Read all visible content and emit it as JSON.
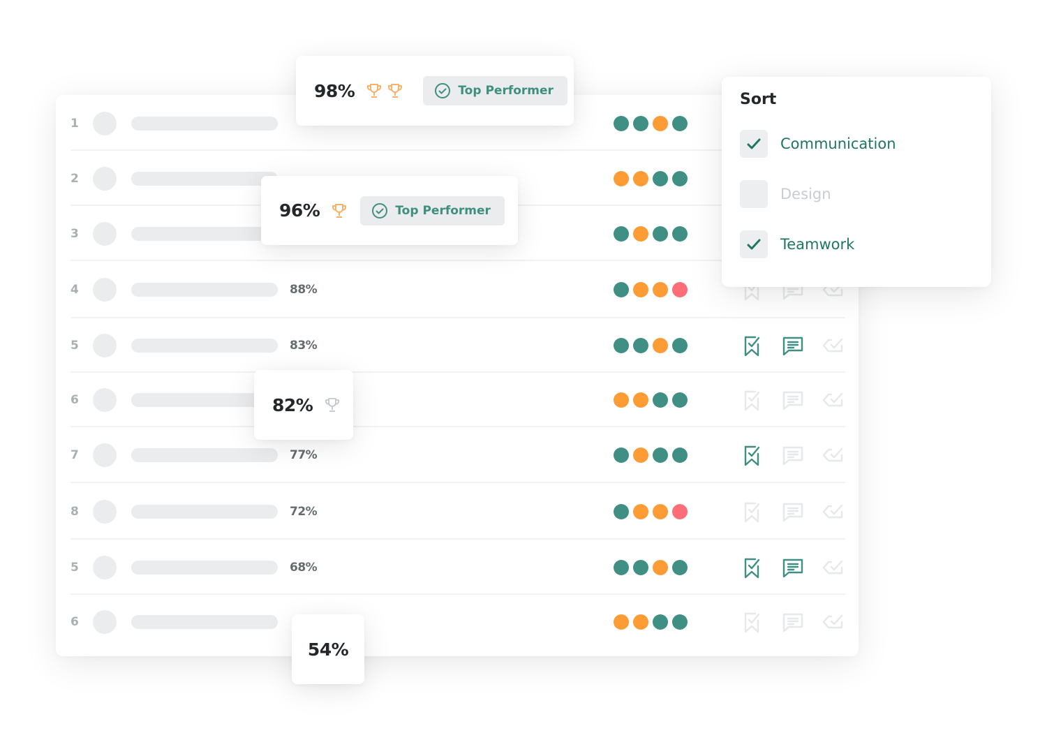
{
  "colors": {
    "teal": "#3f8f84",
    "orange": "#fd9b34",
    "red": "#fd6e78",
    "active_icon": "#3f8f84",
    "inactive_icon": "#e6e8e9",
    "trophy_gold": "#f7b26a",
    "trophy_grey": "#c3c7c9"
  },
  "leaderboard": {
    "rows": [
      {
        "rank": "1",
        "score": "",
        "dots": [
          "teal",
          "teal",
          "orange",
          "teal"
        ],
        "actions": {
          "bookmark": null,
          "comment": null,
          "approve": null
        }
      },
      {
        "rank": "2",
        "score": "",
        "dots": [
          "orange",
          "orange",
          "teal",
          "teal"
        ],
        "actions": {
          "bookmark": null,
          "comment": null,
          "approve": null
        }
      },
      {
        "rank": "3",
        "score": "",
        "dots": [
          "teal",
          "orange",
          "teal",
          "teal"
        ],
        "actions": {
          "bookmark": null,
          "comment": null,
          "approve": null
        }
      },
      {
        "rank": "4",
        "score": "88%",
        "dots": [
          "teal",
          "orange",
          "orange",
          "red"
        ],
        "actions": {
          "bookmark": false,
          "comment": false,
          "approve": false
        }
      },
      {
        "rank": "5",
        "score": "83%",
        "dots": [
          "teal",
          "teal",
          "orange",
          "teal"
        ],
        "actions": {
          "bookmark": true,
          "comment": true,
          "approve": false
        }
      },
      {
        "rank": "6",
        "score": "",
        "dots": [
          "orange",
          "orange",
          "teal",
          "teal"
        ],
        "actions": {
          "bookmark": false,
          "comment": false,
          "approve": false
        }
      },
      {
        "rank": "7",
        "score": "77%",
        "dots": [
          "teal",
          "orange",
          "teal",
          "teal"
        ],
        "actions": {
          "bookmark": true,
          "comment": false,
          "approve": false
        }
      },
      {
        "rank": "8",
        "score": "72%",
        "dots": [
          "teal",
          "orange",
          "orange",
          "red"
        ],
        "actions": {
          "bookmark": false,
          "comment": false,
          "approve": false
        }
      },
      {
        "rank": "5",
        "score": "68%",
        "dots": [
          "teal",
          "teal",
          "orange",
          "teal"
        ],
        "actions": {
          "bookmark": true,
          "comment": true,
          "approve": false
        }
      },
      {
        "rank": "6",
        "score": "",
        "dots": [
          "orange",
          "orange",
          "teal",
          "teal"
        ],
        "actions": {
          "bookmark": false,
          "comment": false,
          "approve": false
        }
      }
    ]
  },
  "popovers": [
    {
      "score": "98%",
      "trophies": [
        "gold",
        "gold"
      ],
      "badge": {
        "label": "Top Performer",
        "icon": "check-circle-icon"
      }
    },
    {
      "score": "96%",
      "trophies": [
        "gold"
      ],
      "badge": {
        "label": "Top Performer",
        "icon": "check-circle-icon"
      }
    },
    {
      "score": "82%",
      "trophies": [
        "grey"
      ],
      "badge": null
    },
    {
      "score": "54%",
      "trophies": [],
      "badge": null
    }
  ],
  "sort": {
    "title": "Sort",
    "options": [
      {
        "label": "Communication",
        "checked": true
      },
      {
        "label": "Design",
        "checked": false
      },
      {
        "label": "Teamwork",
        "checked": true
      }
    ]
  }
}
